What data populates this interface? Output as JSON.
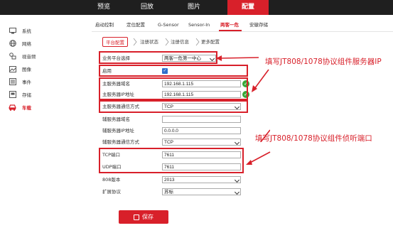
{
  "topnav": {
    "items": [
      {
        "label": "预览",
        "active": false
      },
      {
        "label": "回放",
        "active": false
      },
      {
        "label": "图片",
        "active": false
      },
      {
        "label": "配置",
        "active": true
      }
    ]
  },
  "sidebar": {
    "items": [
      {
        "label": "系统",
        "icon": "monitor-icon"
      },
      {
        "label": "网络",
        "icon": "globe-icon"
      },
      {
        "label": "视音频",
        "icon": "av-icon"
      },
      {
        "label": "图像",
        "icon": "image-icon"
      },
      {
        "label": "事件",
        "icon": "list-icon"
      },
      {
        "label": "存储",
        "icon": "disk-icon"
      },
      {
        "label": "车载",
        "icon": "car-icon",
        "active": true
      }
    ]
  },
  "subtabs": {
    "items": [
      {
        "label": "启动控制"
      },
      {
        "label": "定位配置"
      },
      {
        "label": "G-Sensor"
      },
      {
        "label": "Sensor-In"
      },
      {
        "label": "两客一危",
        "active": true
      },
      {
        "label": "安徽存储"
      }
    ]
  },
  "steps": {
    "items": [
      {
        "label": "平台配置",
        "active": true
      },
      {
        "label": "注册状态"
      },
      {
        "label": "注册信息"
      },
      {
        "label": "更多配置"
      }
    ]
  },
  "form": {
    "platform_label": "业务平台选择",
    "platform_value": "两客一危第一中心",
    "enable_label": "启用",
    "main_domain_label": "主服务器域名",
    "main_domain_value": "192.168.1.115",
    "main_ip_label": "主服务器IP地址",
    "main_ip_value": "192.168.1.115",
    "main_proto_label": "主服务器通信方式",
    "main_proto_value": "TCP",
    "aux_domain_label": "辅服务器域名",
    "aux_domain_value": "",
    "aux_ip_label": "辅服务器IP地址",
    "aux_ip_value": "0.0.0.0",
    "aux_proto_label": "辅服务器通信方式",
    "aux_proto_value": "TCP",
    "tcp_port_label": "TCP端口",
    "tcp_port_value": "7611",
    "udp_port_label": "UDP端口",
    "udp_port_value": "7611",
    "ver_label": "808版本",
    "ver_value": "2013",
    "ext_label": "扩展协议",
    "ext_value": "苏标",
    "save_label": "保存"
  },
  "annotations": {
    "server_ip": "填写JT808/1078协议组件服务器IP",
    "port": "填写JT808/1078协议组件侦听端口"
  },
  "colors": {
    "accent": "#d8202a",
    "topbar": "#1f1f1f",
    "success": "#39a839"
  }
}
